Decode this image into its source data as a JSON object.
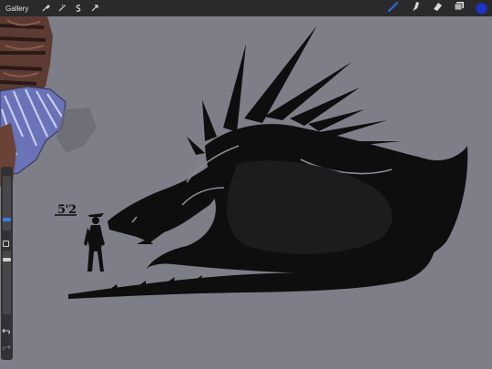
{
  "toolbar": {
    "gallery_label": "Gallery",
    "actions": [
      {
        "name": "actions-icon"
      },
      {
        "name": "adjustments-icon"
      },
      {
        "name": "selection-icon"
      },
      {
        "name": "transform-icon"
      }
    ],
    "tools": [
      {
        "name": "brush-icon",
        "active": true
      },
      {
        "name": "smudge-icon",
        "active": false
      },
      {
        "name": "eraser-icon",
        "active": false
      },
      {
        "name": "layers-icon",
        "active": false
      }
    ],
    "current_color": "#2233c8",
    "accent_color": "#2b6fe0"
  },
  "sidebar": {
    "brush_size_handle_color": "#3b7fe0",
    "opacity_handle_color": "#d0d0d0",
    "modify_button": "modify-button",
    "undo_icon": "undo-icon",
    "redo_icon": "redo-icon"
  },
  "canvas": {
    "background_color": "#7e7e88",
    "height_annotation": "5'2"
  }
}
